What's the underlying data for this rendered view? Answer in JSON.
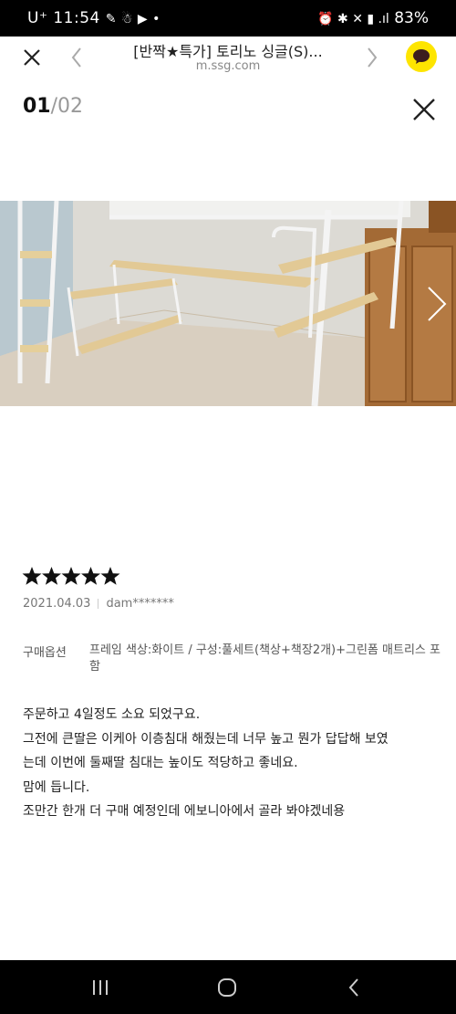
{
  "status_bar": {
    "time": "11:54",
    "carrier": "U⁺",
    "battery": "83%"
  },
  "browser": {
    "title": "[반짝★특가] 토리노 싱글(S)...",
    "url": "m.ssg.com"
  },
  "viewer": {
    "current": "01",
    "total": "/02"
  },
  "review": {
    "rating": 5,
    "date": "2021.04.03",
    "author": "dam*******",
    "option_label": "구매옵션",
    "option_value": "프레임 색상:화이트 / 구성:풀세트(책상+책장2개)+그린폼 매트리스 포함",
    "lines": [
      "주문하고 4일정도 소요 되었구요.",
      "그전에 큰딸은 이케아 이층침대 해줬는데 너무 높고 뭔가 답답해 보였",
      "는데 이번에 둘째딸 침대는 높이도 적당하고 좋네요.",
      "맘에 듭니다.",
      "조만간 한개 더 구매 예정인데 에보니아에서 골라 봐야겠네용"
    ]
  },
  "colors": {
    "kakao_yellow": "#FEE500",
    "star": "#111111"
  }
}
